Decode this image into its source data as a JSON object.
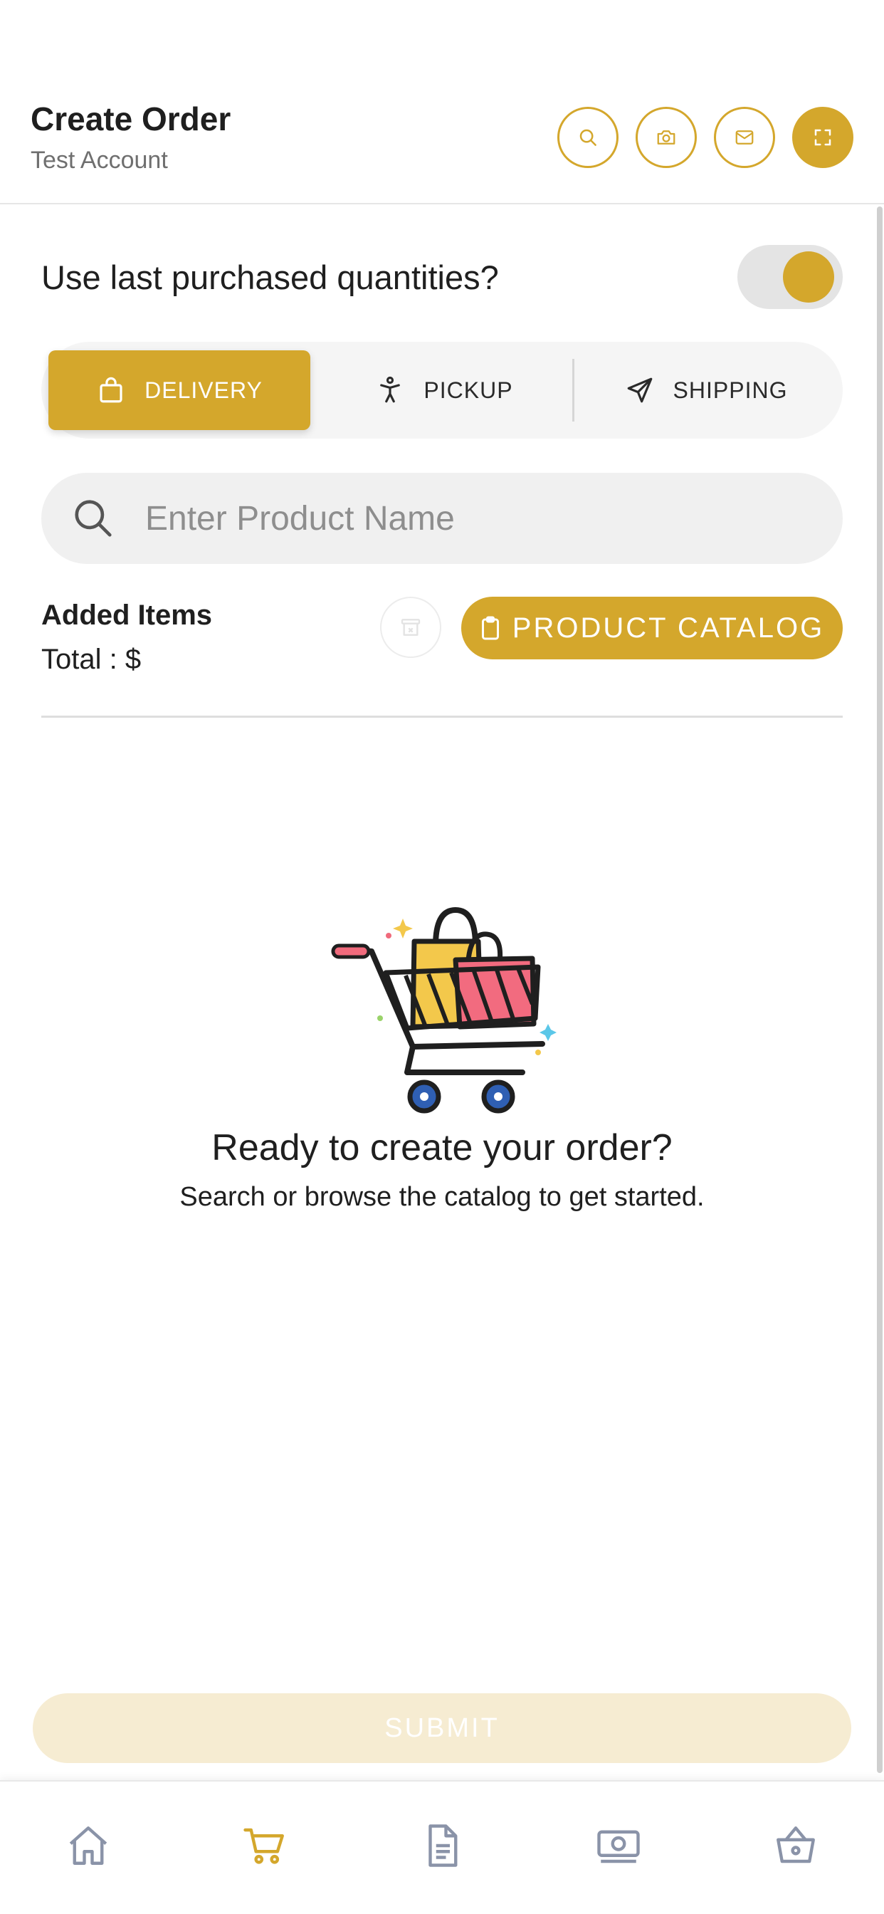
{
  "header": {
    "title": "Create Order",
    "subtitle": "Test Account",
    "actions": [
      {
        "icon": "search-icon"
      },
      {
        "icon": "camera-icon"
      },
      {
        "icon": "mail-icon"
      },
      {
        "icon": "scan-icon"
      }
    ]
  },
  "toggle": {
    "label": "Use last purchased quantities?",
    "checked": true
  },
  "fulfillment": {
    "options": [
      {
        "label": "DELIVERY",
        "icon": "shopping-bag-icon",
        "active": true
      },
      {
        "label": "PICKUP",
        "icon": "person-icon",
        "active": false
      },
      {
        "label": "SHIPPING",
        "icon": "send-icon",
        "active": false
      }
    ]
  },
  "search": {
    "placeholder": "Enter Product Name",
    "value": ""
  },
  "items": {
    "title": "Added Items",
    "total": "Total : $",
    "catalog_label": "PRODUCT CATALOG"
  },
  "empty": {
    "title": "Ready to create your order?",
    "subtitle": "Search or browse the catalog to get started."
  },
  "submit_label": "SUBMIT",
  "nav": [
    {
      "icon": "home-icon",
      "active": false
    },
    {
      "icon": "cart-icon",
      "active": true
    },
    {
      "icon": "document-icon",
      "active": false
    },
    {
      "icon": "money-icon",
      "active": false
    },
    {
      "icon": "basket-icon",
      "active": false
    }
  ],
  "colors": {
    "accent": "#d4a72c",
    "accent_light": "#f6ecd2",
    "nav_inactive": "#8a93a8"
  }
}
